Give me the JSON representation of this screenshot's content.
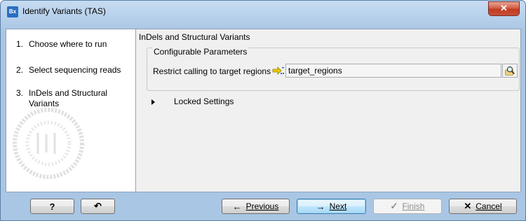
{
  "window": {
    "title": "Identify Variants (TAS)",
    "app_icon_text": "Bx",
    "close_glyph": "✕"
  },
  "steps": [
    {
      "num": "1.",
      "label": "Choose where to run"
    },
    {
      "num": "2.",
      "label": "Select sequencing reads"
    },
    {
      "num": "3.",
      "label": "InDels and Structural Variants"
    }
  ],
  "panel": {
    "title": "InDels and Structural Variants",
    "group_label": "Configurable Parameters",
    "param_label": "Restrict calling to target regions",
    "param_value": "target_regions",
    "locked_label": "Locked Settings"
  },
  "footer": {
    "help_label": "?",
    "reset_glyph": "↶",
    "previous": {
      "arrow": "←",
      "label": "Previous"
    },
    "next": {
      "arrow": "→",
      "label": "Next"
    },
    "finish": {
      "check": "✓",
      "label": "Finish"
    },
    "cancel": {
      "x": "✕",
      "label": "Cancel"
    }
  },
  "colors": {
    "frame": "#a9c6e4",
    "default_button": "#bee6fd",
    "close_button": "#c9503a"
  },
  "icons": [
    "app-icon",
    "close-icon",
    "track-icon",
    "browse-icon",
    "expand-arrow-icon",
    "reset-icon",
    "arrow-left-icon",
    "arrow-right-icon",
    "check-icon",
    "cancel-x-icon"
  ]
}
